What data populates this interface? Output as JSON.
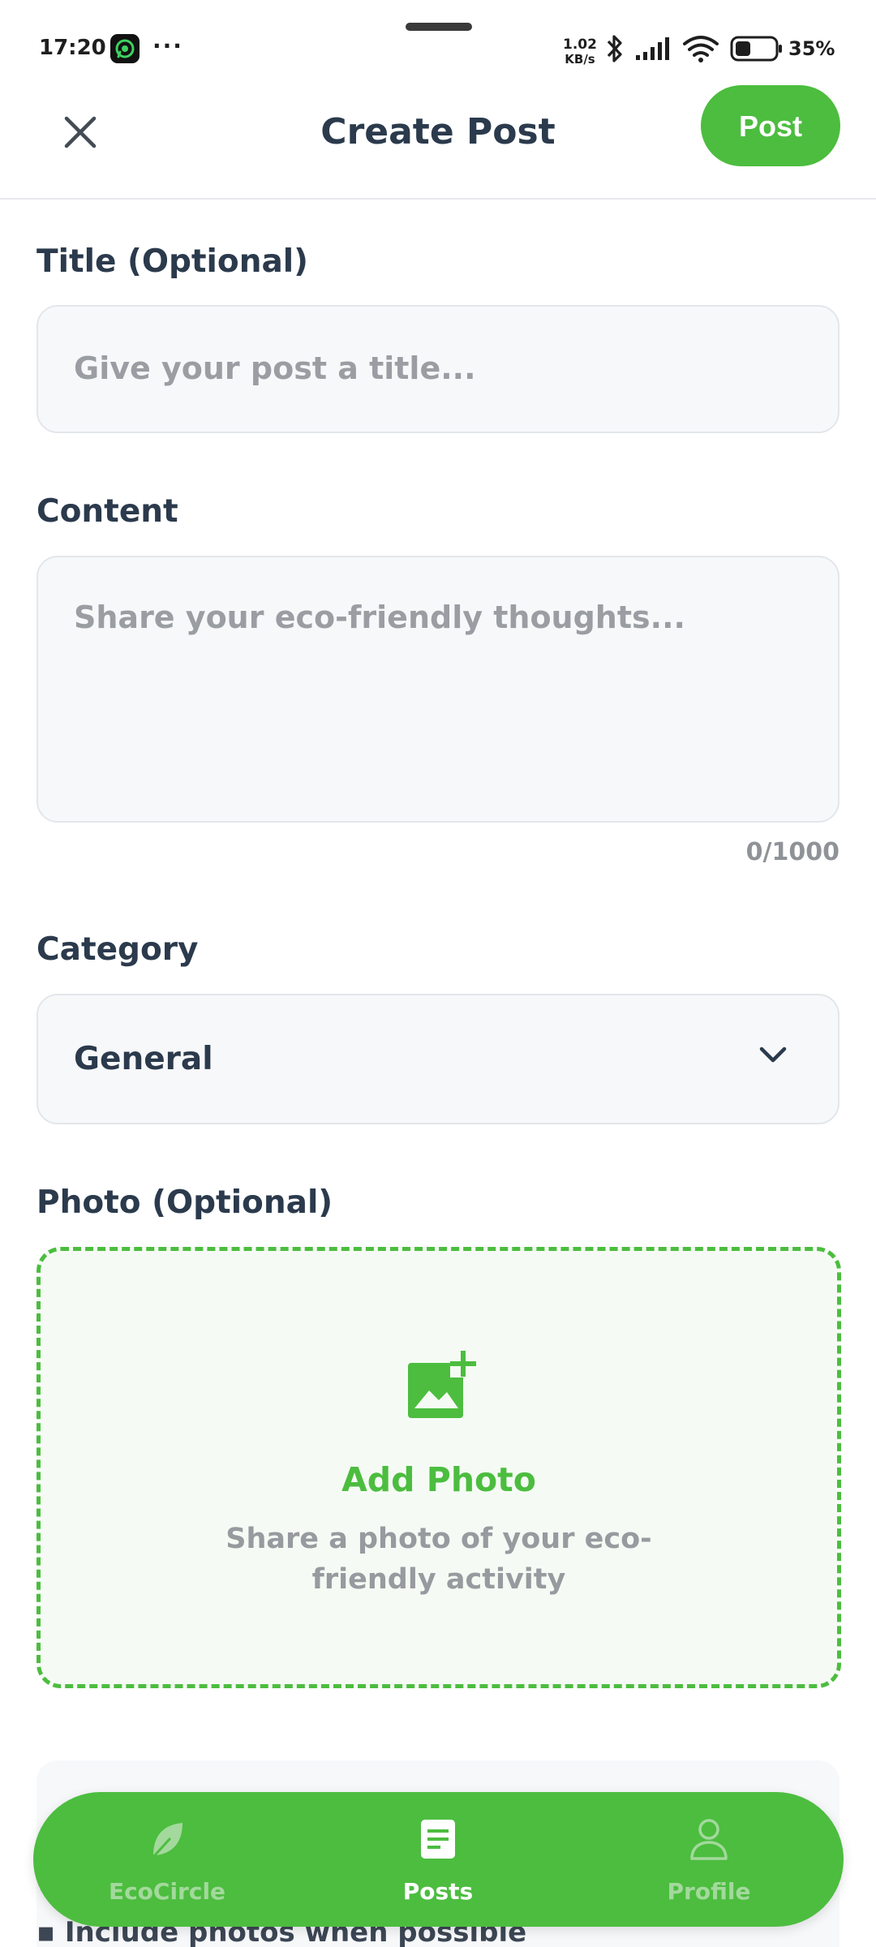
{
  "status_bar": {
    "time": "17:20",
    "more": "···",
    "net_speed_value": "1.02",
    "net_speed_unit": "KB/s",
    "battery": "35%",
    "icons": [
      "whatsapp-icon",
      "bluetooth-icon",
      "signal-icon",
      "wifi-icon",
      "battery-icon"
    ]
  },
  "header": {
    "title": "Create Post",
    "post_label": "Post",
    "close_icon": "close-icon"
  },
  "form": {
    "title_label": "Title (Optional)",
    "title_placeholder": "Give your post a title...",
    "content_label": "Content",
    "content_placeholder": "Share your eco-friendly thoughts...",
    "char_count": "0/1000",
    "category_label": "Category",
    "category_value": "General",
    "photo_label": "Photo (Optional)",
    "add_photo_label": "Add Photo",
    "add_photo_desc": "Share a photo of your eco-friendly activity"
  },
  "tips": {
    "item": "▪ Include photos when possible"
  },
  "bottom_nav": {
    "items": [
      {
        "label": "EcoCircle",
        "icon": "leaf-icon",
        "active": false
      },
      {
        "label": "Posts",
        "icon": "document-icon",
        "active": true
      },
      {
        "label": "Profile",
        "icon": "person-icon",
        "active": false
      }
    ]
  },
  "colors": {
    "accent": "#4cbd3f",
    "text_dark": "#2b3a4c",
    "placeholder": "#9a9ea3",
    "field_bg": "#f7f8fa"
  }
}
